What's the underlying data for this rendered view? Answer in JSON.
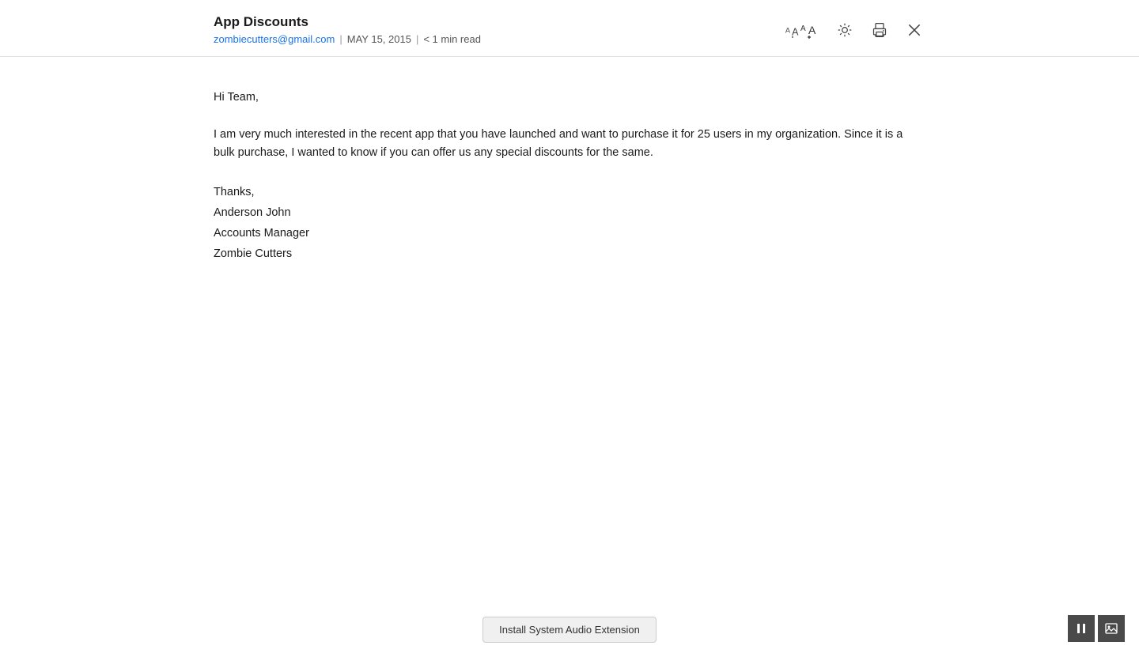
{
  "header": {
    "subject": "App Discounts",
    "sender_email": "zombiecutters@gmail.com",
    "date": "MAY 15, 2015",
    "read_time": "< 1 min read",
    "separator": "|"
  },
  "body": {
    "greeting": "Hi Team,",
    "paragraph1": "I am very much interested in the recent app that you have launched and want to purchase it for 25 users in my organization. Since it is a bulk purchase, I wanted to know if you can offer us any special discounts for the same.",
    "thanks": "Thanks,",
    "name": "Anderson John",
    "title": "Accounts Manager",
    "company": "Zombie Cutters"
  },
  "actions": {
    "font_size_label": "Font size",
    "brightness_label": "Brightness",
    "print_label": "Print",
    "close_label": "Close"
  },
  "bottom": {
    "install_button_label": "Install System Audio Extension",
    "pause_label": "Pause",
    "image_label": "Image"
  }
}
